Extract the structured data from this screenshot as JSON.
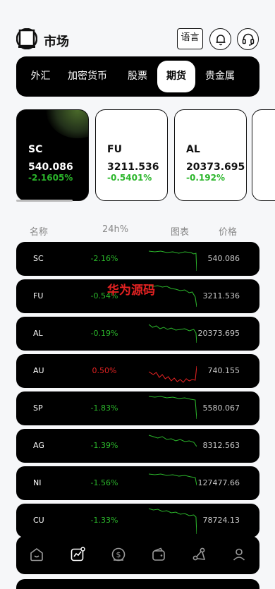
{
  "header": {
    "title": "市场",
    "lang_label": "语言",
    "logo_icon": "logo-square-icon",
    "bell_icon": "bell-icon",
    "support_icon": "headset-icon"
  },
  "tabs": [
    {
      "label": "外汇",
      "active": false
    },
    {
      "label": "加密货币",
      "active": false
    },
    {
      "label": "股票",
      "active": false
    },
    {
      "label": "期货",
      "active": true
    },
    {
      "label": "贵金属",
      "active": false
    }
  ],
  "cards": [
    {
      "symbol": "SC",
      "price": "540.086",
      "change": "-2.1605%"
    },
    {
      "symbol": "FU",
      "price": "3211.536",
      "change": "-0.5401%"
    },
    {
      "symbol": "AL",
      "price": "20373.695",
      "change": "-0.192%"
    }
  ],
  "columns": {
    "name": "名称",
    "change": "24h%",
    "chart": "图表",
    "price": "价格"
  },
  "rows": [
    {
      "symbol": "SC",
      "change": "-2.16%",
      "price": "540.086",
      "trend": "down"
    },
    {
      "symbol": "FU",
      "change": "-0.54%",
      "price": "3211.536",
      "trend": "down"
    },
    {
      "symbol": "AL",
      "change": "-0.19%",
      "price": "20373.695",
      "trend": "down"
    },
    {
      "symbol": "AU",
      "change": "0.50%",
      "price": "740.155",
      "trend": "up"
    },
    {
      "symbol": "SP",
      "change": "-1.83%",
      "price": "5580.067",
      "trend": "down"
    },
    {
      "symbol": "AG",
      "change": "-1.39%",
      "price": "8312.563",
      "trend": "down"
    },
    {
      "symbol": "NI",
      "change": "-1.56%",
      "price": "127477.66",
      "trend": "down"
    },
    {
      "symbol": "CU",
      "change": "-1.33%",
      "price": "78724.13",
      "trend": "down"
    }
  ],
  "watermark": "华为源码",
  "bottom_nav": [
    {
      "icon": "home-icon",
      "active": false
    },
    {
      "icon": "market-chart-icon",
      "active": true
    },
    {
      "icon": "dollar-coin-icon",
      "active": false
    },
    {
      "icon": "wallet-icon",
      "active": false
    },
    {
      "icon": "share-network-icon",
      "active": false
    },
    {
      "icon": "user-icon",
      "active": false
    }
  ],
  "colors": {
    "up": "#e32222",
    "down": "#2bb62b",
    "background": "#f6f7f9",
    "panel": "#000000"
  }
}
